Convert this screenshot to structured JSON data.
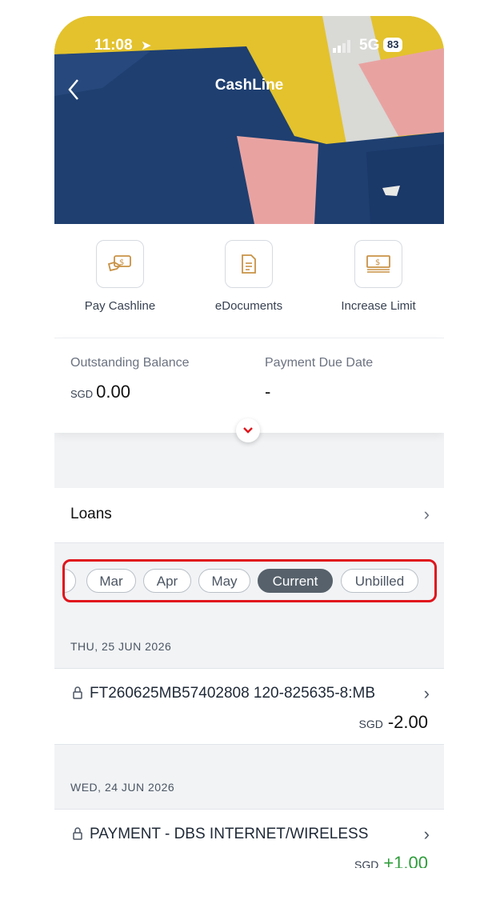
{
  "status_bar": {
    "time": "11:08",
    "network": "5G",
    "battery": "83"
  },
  "header": {
    "title": "CashLine",
    "back_icon": "chevron-left-icon"
  },
  "quick_actions": [
    {
      "label": "Pay Cashline",
      "icon": "pay-cash-icon"
    },
    {
      "label": "eDocuments",
      "icon": "document-icon"
    },
    {
      "label": "Increase Limit",
      "icon": "money-stack-icon"
    }
  ],
  "balance": {
    "outstanding_label": "Outstanding Balance",
    "currency": "SGD",
    "outstanding_value": "0.00",
    "due_label": "Payment Due Date",
    "due_value": "-"
  },
  "loans": {
    "label": "Loans"
  },
  "months": [
    "Mar",
    "Apr",
    "May",
    "Current",
    "Unbilled"
  ],
  "selected_month": "Current",
  "transactions": [
    {
      "date": "THU, 25 JUN 2026",
      "description": "FT260625MB57402808 120-825635-8:MB",
      "currency": "SGD",
      "amount": "-2.00"
    },
    {
      "date": "WED, 24 JUN 2026",
      "description": "PAYMENT - DBS INTERNET/WIRELESS",
      "currency": "SGD",
      "amount": "+1.00"
    }
  ],
  "colors": {
    "accent_red": "#e0141c",
    "positive_green": "#2e9d3a",
    "active_pill": "#56616b"
  }
}
